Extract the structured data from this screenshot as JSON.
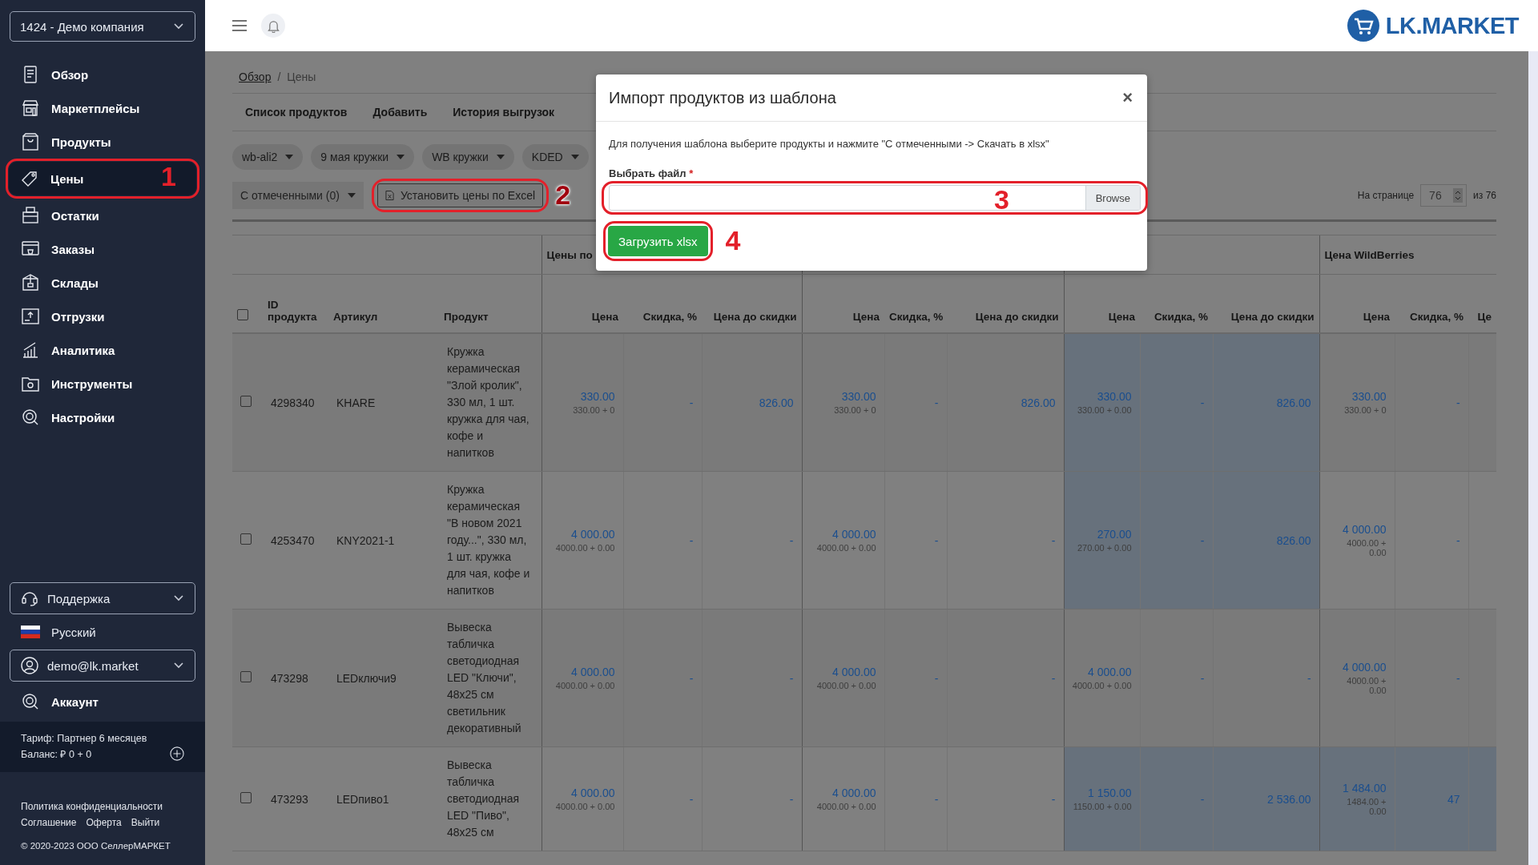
{
  "company": "1424 - Демо компания",
  "nav": [
    {
      "label": "Обзор",
      "selected": false
    },
    {
      "label": "Маркетплейсы",
      "selected": false
    },
    {
      "label": "Продукты",
      "selected": false
    },
    {
      "label": "Цены",
      "selected": true,
      "annotation": "1"
    },
    {
      "label": "Остатки",
      "selected": false
    },
    {
      "label": "Заказы",
      "selected": false
    },
    {
      "label": "Склады",
      "selected": false
    },
    {
      "label": "Отгрузки",
      "selected": false
    },
    {
      "label": "Аналитика",
      "selected": false
    },
    {
      "label": "Инструменты",
      "selected": false
    },
    {
      "label": "Настройки",
      "selected": false
    }
  ],
  "support": "Поддержка",
  "language": "Русский",
  "user": "demo@lk.market",
  "account": "Аккаунт",
  "tariff": "Тариф: Партнер 6 месяцев",
  "balance": "Баланс: ₽ 0 + 0",
  "footer_links": [
    "Политика конфиденциальности",
    "Соглашение",
    "Оферта",
    "Выйти"
  ],
  "copyright": "© 2020-2023 ООО СеллерМАРКЕТ",
  "logo": "LK.MARKET",
  "breadcrumb": {
    "link": "Обзор",
    "separator": "/",
    "current": "Цены"
  },
  "tabs": [
    "Список продуктов",
    "Добавить",
    "История выгрузок"
  ],
  "filters": [
    "wb-ali2",
    "9 мая кружки",
    "WB кружки",
    "KDED"
  ],
  "bulk_action": "С отмеченными (0)",
  "excel_button": {
    "label": "Установить цены по Excel",
    "annotation": "2"
  },
  "pager": {
    "label": "На странице",
    "value": "76",
    "total": "из 76"
  },
  "table": {
    "header_checked": false,
    "columns": [
      "ID продукта",
      "Артикул",
      "Продукт"
    ],
    "groups": [
      {
        "title": "Цены по",
        "columns": [
          "Цена",
          "Скидка, %",
          "Цена до скидки"
        ]
      },
      {
        "columns": [
          "Цена",
          "Скидка, %",
          "Цена до скидки"
        ]
      },
      {
        "columns": [
          "Цена",
          "Скидка, %",
          "Цена до скидки"
        ]
      },
      {
        "title": "Цена WildBerries",
        "columns": [
          "Цена",
          "Скидка, %",
          "Це"
        ]
      }
    ],
    "rows": [
      {
        "checked": false,
        "id": "4298340",
        "sku": "KHARE",
        "product": "Кружка керамическая \"Злой кролик\", 330 мл, 1 шт. кружка для чая, кофе и напитков",
        "groups": [
          {
            "price": "330.00",
            "sub": "330.00 + 0",
            "discount": "-",
            "before": "826.00",
            "highlighted": false
          },
          {
            "price": "330.00",
            "sub": "330.00 + 0",
            "discount": "-",
            "before": "826.00",
            "highlighted": false
          },
          {
            "price": "330.00",
            "sub": "330.00 + 0.00",
            "discount": "-",
            "before": "826.00",
            "highlighted": true
          },
          {
            "price": "330.00",
            "sub": "330.00 + 0",
            "discount": "-",
            "highlighted": false
          }
        ]
      },
      {
        "checked": false,
        "id": "4253470",
        "sku": "KNY2021-1",
        "product": "Кружка керамическая \"В новом 2021 году...\", 330 мл, 1 шт. кружка для чая, кофе и напитков",
        "groups": [
          {
            "price": "4 000.00",
            "sub": "4000.00 + 0.00",
            "discount": "-",
            "before": "-",
            "highlighted": false
          },
          {
            "price": "4 000.00",
            "sub": "4000.00 + 0.00",
            "discount": "-",
            "before": "-",
            "highlighted": false
          },
          {
            "price": "270.00",
            "sub": "270.00 + 0.00",
            "discount": "-",
            "before": "826.00",
            "highlighted": true
          },
          {
            "price": "4 000.00",
            "sub": "4000.00 + 0.00",
            "discount": "-",
            "highlighted": false
          }
        ]
      },
      {
        "checked": false,
        "id": "473298",
        "sku": "LEDключи9",
        "product": "Вывеска табличка светодиодная LED \"Ключи\", 48x25 см светильник декоративный",
        "groups": [
          {
            "price": "4 000.00",
            "sub": "4000.00 + 0.00",
            "discount": "-",
            "before": "-",
            "highlighted": false
          },
          {
            "price": "4 000.00",
            "sub": "4000.00 + 0.00",
            "discount": "-",
            "before": "-",
            "highlighted": false
          },
          {
            "price": "4 000.00",
            "sub": "4000.00 + 0.00",
            "discount": "-",
            "before": "-",
            "highlighted": false
          },
          {
            "price": "4 000.00",
            "sub": "4000.00 + 0.00",
            "discount": "-",
            "highlighted": false
          }
        ]
      },
      {
        "checked": false,
        "id": "473293",
        "sku": "LEDпиво1",
        "product": "Вывеска табличка светодиодная LED \"Пиво\", 48x25 см",
        "groups": [
          {
            "price": "4 000.00",
            "sub": "4000.00 + 0.00",
            "discount": "-",
            "before": "-",
            "highlighted": false
          },
          {
            "price": "4 000.00",
            "sub": "4000.00 + 0.00",
            "discount": "-",
            "before": "-",
            "highlighted": false
          },
          {
            "price": "1 150.00",
            "sub": "1150.00 + 0.00",
            "discount": "-",
            "before": "2 536.00",
            "highlighted": true
          },
          {
            "price": "1 484.00",
            "sub": "1484.00 + 0.00",
            "discount": "47",
            "highlighted": true
          }
        ]
      }
    ]
  },
  "modal": {
    "title": "Импорт продуктов из шаблона",
    "close": "×",
    "hint": "Для получения шаблона выберите продукты и нажмите \"С отмеченными -> Скачать в xlsx\"",
    "file_label": "Выбрать файл",
    "required_mark": "*",
    "browse": "Browse",
    "file_annotation": "3",
    "submit": "Загрузить xlsx",
    "submit_annotation": "4"
  }
}
